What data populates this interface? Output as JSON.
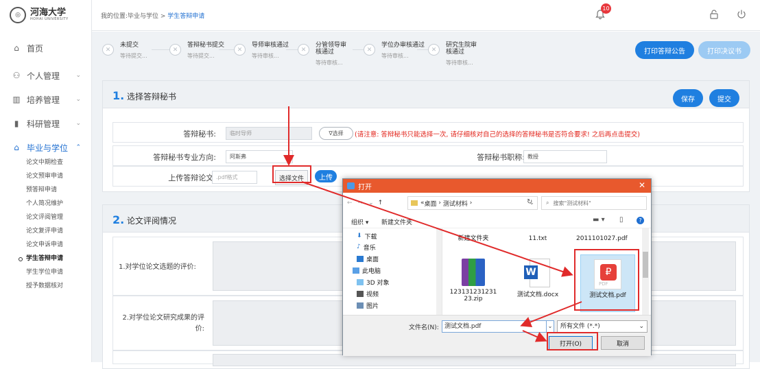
{
  "logo": {
    "name": "河海大学",
    "sub": "HOHAI UNIVERSITY"
  },
  "breadcrumb": {
    "prefix": "我的位置:毕业与学位 > ",
    "current": "学生答辩申请"
  },
  "notification_count": "10",
  "sidebar": {
    "items": [
      {
        "label": "首页",
        "icon": "home-icon"
      },
      {
        "label": "个人管理",
        "icon": "person-icon"
      },
      {
        "label": "培养管理",
        "icon": "chart-icon"
      },
      {
        "label": "科研管理",
        "icon": "bars-icon"
      },
      {
        "label": "毕业与学位",
        "icon": "graduation-cap-icon"
      }
    ],
    "subitems": [
      "论文中期检查",
      "论文预审申请",
      "预答辩申请",
      "个人简况维护",
      "论文评阅管理",
      "论文复评申请",
      "论文申诉申请",
      "学生答辩申请",
      "学生学位申请",
      "授予数据核对"
    ]
  },
  "steps": [
    {
      "title": "未提交",
      "status": "等待提交..."
    },
    {
      "title": "答辩秘书提交",
      "status": "等待提交..."
    },
    {
      "title": "导师审核通过",
      "status": "等待审核..."
    },
    {
      "title": "分管领导审核通过",
      "status": "等待审核..."
    },
    {
      "title": "学位办审核通过",
      "status": "等待审核..."
    },
    {
      "title": "研究生院审核通过",
      "status": "等待审核..."
    }
  ],
  "buttons": {
    "print_notice": "打印答辩公告",
    "print_resolution": "打印决议书",
    "save": "保存",
    "submit": "提交"
  },
  "section1": {
    "num": "1.",
    "title": "选择答辩秘书",
    "secretary_label": "答辩秘书:",
    "secretary_value": "临时导师",
    "select_btn": "∇选择",
    "warning": "(请注意: 答辩秘书只能选择一次, 请仔细核对自己的选择的答辩秘书是否符合要求! 之后再点击提交)",
    "major_label": "答辩秘书专业方向:",
    "major_value": "阿斯弗",
    "title_label": "答辩秘书职称:",
    "title_value": "教授",
    "upload_label": "上传答辩论文:",
    "upload_placeholder": ".pdf格式",
    "choose_file": "选择文件",
    "upload_btn": "上传"
  },
  "section2": {
    "num": "2.",
    "title": "论文评阅情况",
    "q1": "1.对学位论文选题的评价:",
    "q2": "2.对学位论文研究成果的评价:"
  },
  "dialog": {
    "title": "打开",
    "path": [
      "桌面",
      "测试材料"
    ],
    "search_placeholder": "搜索\"测试材料\"",
    "organize": "组织 ▾",
    "new_folder": "新建文件夹",
    "tree": [
      "下载",
      "音乐",
      "桌面",
      "此电脑",
      "3D 对象",
      "视频",
      "图片"
    ],
    "files": [
      {
        "name": "新建文件夹"
      },
      {
        "name": "11.txt"
      },
      {
        "name": "2011101027.pdf"
      },
      {
        "name": "12313123123123.zip"
      },
      {
        "name": "测试文档.docx"
      },
      {
        "name": "测试文档.pdf"
      }
    ],
    "filename_label": "文件名(N):",
    "filename_value": "测试文档.pdf",
    "filter": "所有文件 (*.*)",
    "open": "打开(O)",
    "cancel": "取消"
  }
}
